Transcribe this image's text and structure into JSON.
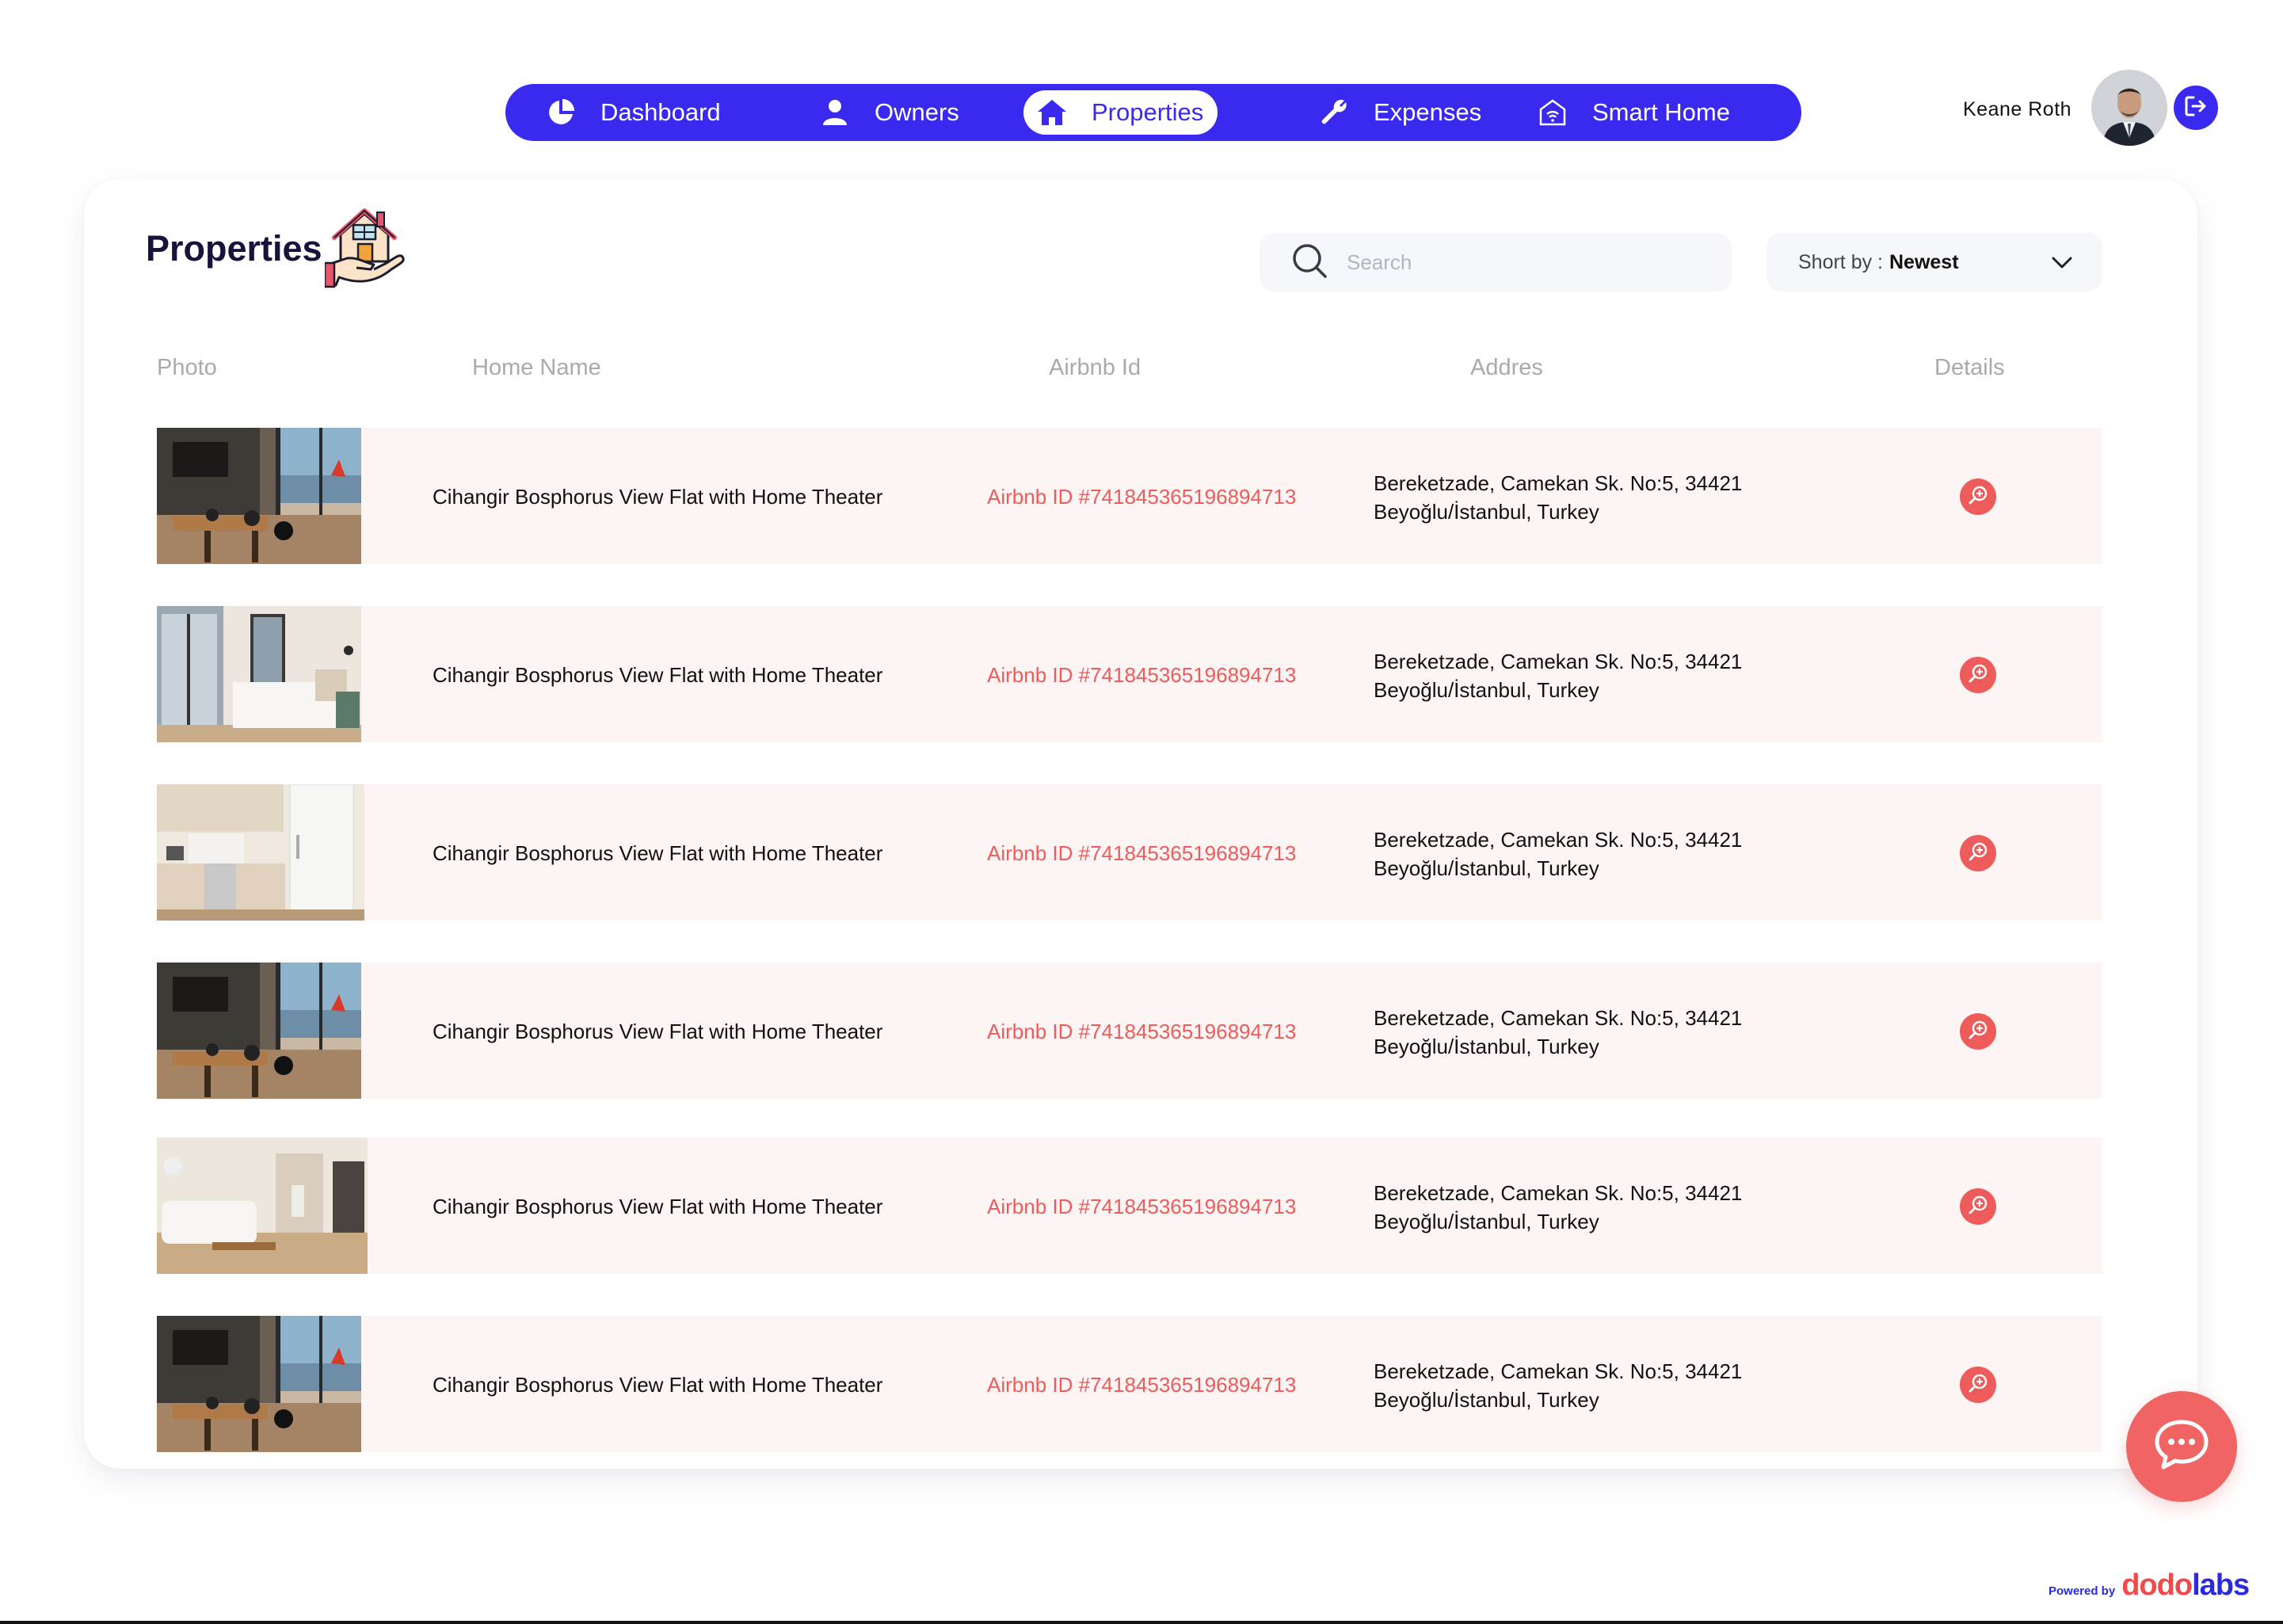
{
  "nav": {
    "items": [
      {
        "label": "Dashboard",
        "icon": "pie-chart-icon",
        "active": false
      },
      {
        "label": "Owners",
        "icon": "user-icon",
        "active": false
      },
      {
        "label": "Properties",
        "icon": "home-icon",
        "active": true
      },
      {
        "label": "Expenses",
        "icon": "wrench-icon",
        "active": false
      },
      {
        "label": "Smart Home",
        "icon": "smart-home-icon",
        "active": false
      }
    ],
    "accent": "#3a2af0"
  },
  "user": {
    "name": "Keane Roth",
    "logout_icon": "logout-icon"
  },
  "page": {
    "title": "Properties",
    "title_icon": "house-in-hand-icon"
  },
  "search": {
    "placeholder": "Search",
    "value": ""
  },
  "sort": {
    "label": "Short by :",
    "value": "Newest"
  },
  "table": {
    "headers": {
      "photo": "Photo",
      "name": "Home Name",
      "airbnb": "Airbnb Id",
      "address": "Addres",
      "details": "Details"
    },
    "rows": [
      {
        "photo": "dining-room-bosphorus-view",
        "name": "Cihangir Bosphorus View Flat with Home Theater",
        "airbnb_id": "Airbnb ID #74184536519​6894713",
        "address_line1": "Bereketzade, Camekan Sk. No:5, 34421",
        "address_line2": "Beyoğlu/İstanbul, Turkey"
      },
      {
        "photo": "bedroom",
        "name": "Cihangir Bosphorus View Flat with Home Theater",
        "airbnb_id": "Airbnb ID #741845365196894713",
        "address_line1": "Bereketzade, Camekan Sk. No:5, 34421",
        "address_line2": "Beyoğlu/İstanbul, Turkey"
      },
      {
        "photo": "kitchen",
        "name": "Cihangir Bosphorus View Flat with Home Theater",
        "airbnb_id": "Airbnb ID #741845365196894713",
        "address_line1": "Bereketzade, Camekan Sk. No:5, 34421",
        "address_line2": "Beyoğlu/İstanbul, Turkey"
      },
      {
        "photo": "dining-room-bosphorus-view",
        "name": "Cihangir Bosphorus View Flat with Home Theater",
        "airbnb_id": "Airbnb ID #741845365196894713",
        "address_line1": "Bereketzade, Camekan Sk. No:5, 34421",
        "address_line2": "Beyoğlu/İstanbul, Turkey"
      },
      {
        "photo": "living-room",
        "name": "Cihangir Bosphorus View Flat with Home Theater",
        "airbnb_id": "Airbnb ID #741845365196894713",
        "address_line1": "Bereketzade, Camekan Sk. No:5, 34421",
        "address_line2": "Beyoğlu/İstanbul, Turkey"
      },
      {
        "photo": "dining-room-bosphorus-view",
        "name": "Cihangir Bosphorus View Flat with Home Theater",
        "airbnb_id": "Airbnb ID #741845365196894713",
        "address_line1": "Bereketzade, Camekan Sk. No:5, 34421",
        "address_line2": "Beyoğlu/İstanbul, Turkey"
      }
    ],
    "details_icon": "zoom-in-icon",
    "id_color": "#ee5b5b",
    "row_bg": "#fdf5f4"
  },
  "chat": {
    "icon": "chat-bubble-icon",
    "color": "#f06464"
  },
  "footer": {
    "powered_by": "Powered by",
    "brand_part1": "dodo",
    "brand_part2": "labs"
  }
}
